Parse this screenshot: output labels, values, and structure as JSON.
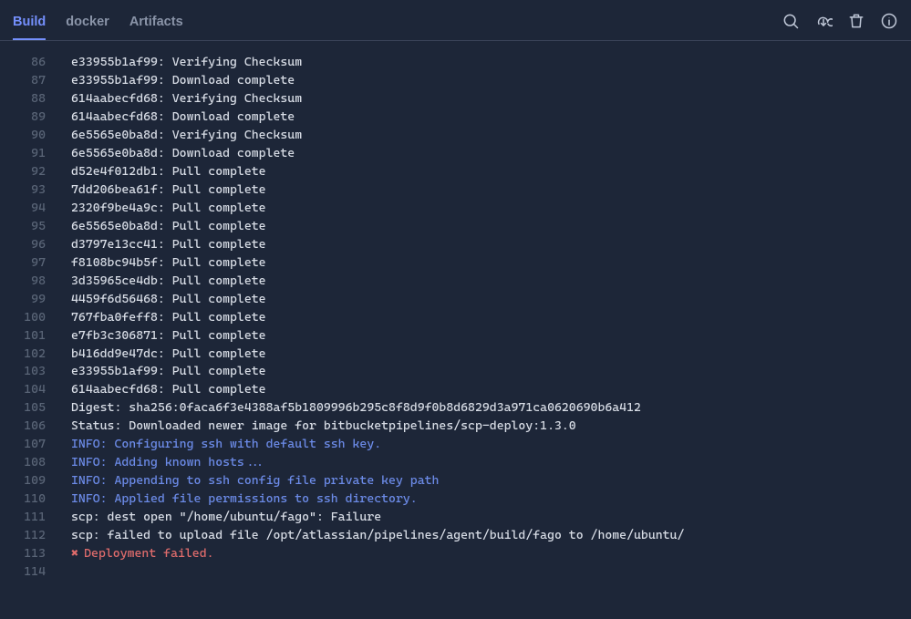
{
  "tabs": {
    "build": "Build",
    "docker": "docker",
    "artifacts": "Artifacts"
  },
  "colors": {
    "bg": "#1d2638",
    "info": "#6c8be8",
    "error": "#e06c6c",
    "tab_active": "#748ffc"
  },
  "lines": [
    {
      "n": 86,
      "type": "plain",
      "text": "e33955b1af99: Verifying Checksum"
    },
    {
      "n": 87,
      "type": "plain",
      "text": "e33955b1af99: Download complete"
    },
    {
      "n": 88,
      "type": "plain",
      "text": "614aabecfd68: Verifying Checksum"
    },
    {
      "n": 89,
      "type": "plain",
      "text": "614aabecfd68: Download complete"
    },
    {
      "n": 90,
      "type": "plain",
      "text": "6e5565e0ba8d: Verifying Checksum"
    },
    {
      "n": 91,
      "type": "plain",
      "text": "6e5565e0ba8d: Download complete"
    },
    {
      "n": 92,
      "type": "plain",
      "text": "d52e4f012db1: Pull complete"
    },
    {
      "n": 93,
      "type": "plain",
      "text": "7dd206bea61f: Pull complete"
    },
    {
      "n": 94,
      "type": "plain",
      "text": "2320f9be4a9c: Pull complete"
    },
    {
      "n": 95,
      "type": "plain",
      "text": "6e5565e0ba8d: Pull complete"
    },
    {
      "n": 96,
      "type": "plain",
      "text": "d3797e13cc41: Pull complete"
    },
    {
      "n": 97,
      "type": "plain",
      "text": "f8108bc94b5f: Pull complete"
    },
    {
      "n": 98,
      "type": "plain",
      "text": "3d35965ce4db: Pull complete"
    },
    {
      "n": 99,
      "type": "plain",
      "text": "4459f6d56468: Pull complete"
    },
    {
      "n": 100,
      "type": "plain",
      "text": "767fba0feff8: Pull complete"
    },
    {
      "n": 101,
      "type": "plain",
      "text": "e7fb3c306871: Pull complete"
    },
    {
      "n": 102,
      "type": "plain",
      "text": "b416dd9e47dc: Pull complete"
    },
    {
      "n": 103,
      "type": "plain",
      "text": "e33955b1af99: Pull complete"
    },
    {
      "n": 104,
      "type": "plain",
      "text": "614aabecfd68: Pull complete"
    },
    {
      "n": 105,
      "type": "plain",
      "text": "Digest: sha256:0faca6f3e4388af5b1809996b295c8f8d9f0b8d6829d3a971ca0620690b6a412"
    },
    {
      "n": 106,
      "type": "plain",
      "text": "Status: Downloaded newer image for bitbucketpipelines/scp-deploy:1.3.0"
    },
    {
      "n": 107,
      "type": "info",
      "text": "INFO: Configuring ssh with default ssh key."
    },
    {
      "n": 108,
      "type": "info",
      "text": "INFO: Adding known hosts..."
    },
    {
      "n": 109,
      "type": "info",
      "text": "INFO: Appending to ssh config file private key path"
    },
    {
      "n": 110,
      "type": "info",
      "text": "INFO: Applied file permissions to ssh directory."
    },
    {
      "n": 111,
      "type": "plain",
      "text": "scp: dest open \"/home/ubuntu/fago\": Failure"
    },
    {
      "n": 112,
      "type": "plain",
      "text": "scp: failed to upload file /opt/atlassian/pipelines/agent/build/fago to /home/ubuntu/"
    },
    {
      "n": 113,
      "type": "error",
      "text": "Deployment failed.",
      "fail_marker": "✖"
    },
    {
      "n": 114,
      "type": "plain",
      "text": ""
    }
  ]
}
